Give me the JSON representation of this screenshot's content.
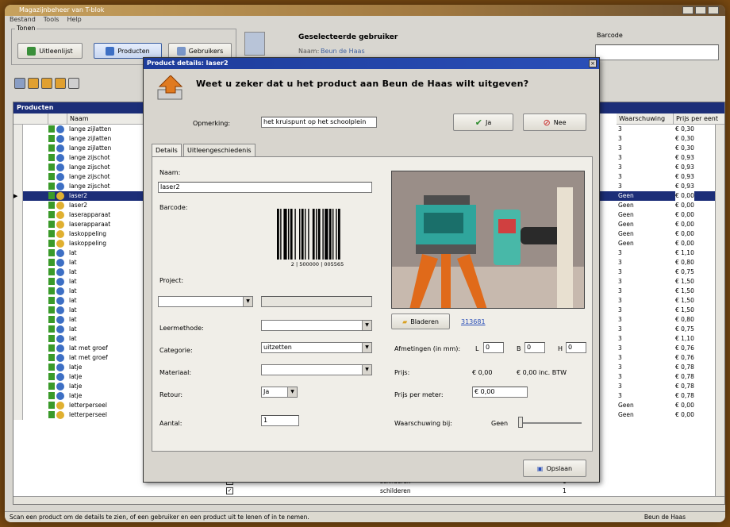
{
  "window": {
    "title": "Magazijnbeheer van T-blok",
    "menu": [
      "Bestand",
      "Tools",
      "Help"
    ]
  },
  "toolbar": {
    "group_label": "Tonen",
    "btn_uitleen": "Uitleenlijst",
    "btn_producten": "Producten",
    "btn_gebruikers": "Gebruikers",
    "selected_user_title": "Geselecteerde gebruiker",
    "selected_user_name_label": "Naam:",
    "selected_user_name": "Beun de Haas",
    "barcode_label": "Barcode",
    "barcode_value": ""
  },
  "grid": {
    "title": "Producten",
    "col_name": "Naam",
    "col_warning": "Waarschuwing",
    "col_price": "Prijs per eent",
    "rows": [
      {
        "name": "lange zijlatten",
        "w": "3",
        "p": "€ 0,30"
      },
      {
        "name": "lange zijlatten",
        "w": "3",
        "p": "€ 0,30"
      },
      {
        "name": "lange zijlatten",
        "w": "3",
        "p": "€ 0,30"
      },
      {
        "name": "lange zijschot",
        "w": "3",
        "p": "€ 0,93"
      },
      {
        "name": "lange zijschot",
        "w": "3",
        "p": "€ 0,93"
      },
      {
        "name": "lange zijschot",
        "w": "3",
        "p": "€ 0,93"
      },
      {
        "name": "lange zijschot",
        "w": "3",
        "p": "€ 0,93"
      },
      {
        "name": "laser2",
        "w": "Geen",
        "p": "€ 0,00"
      },
      {
        "name": "laser2",
        "w": "Geen",
        "p": "€ 0,00"
      },
      {
        "name": "laserapparaat",
        "w": "Geen",
        "p": "€ 0,00"
      },
      {
        "name": "laserapparaat",
        "w": "Geen",
        "p": "€ 0,00"
      },
      {
        "name": "laskoppeling",
        "w": "Geen",
        "p": "€ 0,00"
      },
      {
        "name": "laskoppeling",
        "w": "Geen",
        "p": "€ 0,00"
      },
      {
        "name": "lat",
        "w": "3",
        "p": "€ 1,10"
      },
      {
        "name": "lat",
        "w": "3",
        "p": "€ 0,80"
      },
      {
        "name": "lat",
        "w": "3",
        "p": "€ 0,75"
      },
      {
        "name": "lat",
        "w": "3",
        "p": "€ 1,50"
      },
      {
        "name": "lat",
        "w": "3",
        "p": "€ 1,50"
      },
      {
        "name": "lat",
        "w": "3",
        "p": "€ 1,50"
      },
      {
        "name": "lat",
        "w": "3",
        "p": "€ 1,50"
      },
      {
        "name": "lat",
        "w": "3",
        "p": "€ 0,80"
      },
      {
        "name": "lat",
        "w": "3",
        "p": "€ 0,75"
      },
      {
        "name": "lat",
        "w": "3",
        "p": "€ 1,10"
      },
      {
        "name": "lat met groef",
        "w": "3",
        "p": "€ 0,76"
      },
      {
        "name": "lat met groef",
        "w": "3",
        "p": "€ 0,76"
      },
      {
        "name": "latje",
        "w": "3",
        "p": "€ 0,78"
      },
      {
        "name": "latje",
        "w": "3",
        "p": "€ 0,78"
      },
      {
        "name": "latje",
        "w": "3",
        "p": "€ 0,78"
      },
      {
        "name": "latje",
        "w": "3",
        "p": "€ 0,78"
      },
      {
        "name": "letterperseel",
        "w": "Geen",
        "p": "€ 0,00"
      },
      {
        "name": "letterperseel",
        "w": "Geen",
        "p": "€ 0,00"
      }
    ],
    "extra_cells": [
      "schilderen",
      "1",
      "schilderen",
      "1"
    ]
  },
  "status": {
    "text": "Scan een product om de details te zien, of een gebruiker en een product uit te lenen of in te nemen.",
    "user": "Beun de Haas"
  },
  "dialog": {
    "title": "Product details: laser2",
    "question": "Weet u zeker dat u het product aan Beun de Haas wilt uitgeven?",
    "opmerking_label": "Opmerking:",
    "opmerking_value": "het kruispunt op het schoolplein",
    "btn_ja": "Ja",
    "btn_nee": "Nee",
    "tab_details": "Details",
    "tab_history": "Uitleengeschiedenis",
    "naam_label": "Naam:",
    "naam_value": "laser2",
    "barcode_label": "Barcode:",
    "barcode_digits": "2 | 500000 | 005565",
    "project_label": "Project:",
    "leermethode_label": "Leermethode:",
    "categorie_label": "Categorie:",
    "categorie_value": "uitzetten",
    "materiaal_label": "Materiaal:",
    "retour_label": "Retour:",
    "retour_value": "Ja",
    "aantal_label": "Aantal:",
    "aantal_value": "1",
    "bladeren": "Bladeren",
    "image_link": "313681",
    "afmetingen_label": "Afmetingen (in mm):",
    "l_label": "L",
    "l_value": "0",
    "b_label": "B",
    "b_value": "0",
    "h_label": "H",
    "h_value": "0",
    "prijs_label": "Prijs:",
    "prijs_value": "€ 0,00",
    "prijs_incl": "€ 0,00 inc. BTW",
    "ppm_label": "Prijs per meter:",
    "ppm_value": "€ 0,00",
    "warn_label": "Waarschuwing bij:",
    "warn_value": "Geen",
    "opslaan": "Opslaan"
  },
  "colors": {
    "header_blue": "#1c2e78",
    "dialog_title": "#1d3c9a",
    "frame_bg": "#d8d6d0",
    "outer_bg": "#7a4a12"
  }
}
